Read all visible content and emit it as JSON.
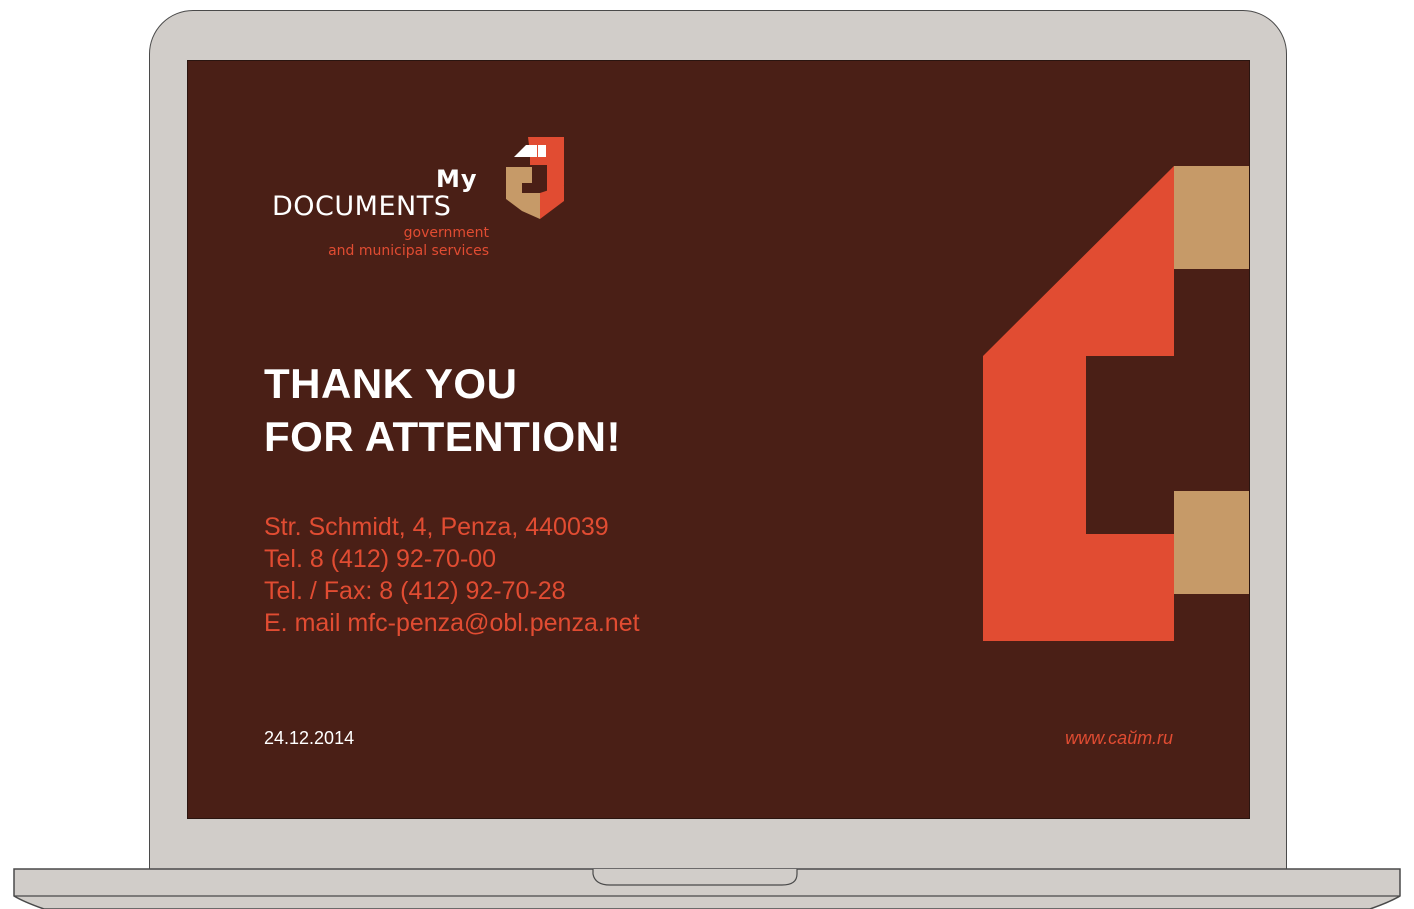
{
  "colors": {
    "slide_background": "#4a1f16",
    "accent_red": "#e14c32",
    "accent_tan": "#c69a68",
    "laptop_body": "#d1cdc9",
    "text_white": "#ffffff"
  },
  "logo": {
    "line1": "My",
    "line2": "DOCUMENTS",
    "subtitle_line1": "government",
    "subtitle_line2": "and municipal services",
    "mark_icon": "my-documents-logo-mark"
  },
  "heading": {
    "line1": "THANK YOU",
    "line2": "FOR ATTENTION!"
  },
  "contacts": {
    "address": "Str. Schmidt, 4, Penza, 440039",
    "tel": "Tel. 8 (412) 92-70-00",
    "fax": "Tel. / Fax: 8 (412) 92-70-28",
    "email": "E. mail mfc-penza@obl.penza.net"
  },
  "footer": {
    "date": "24.12.2014",
    "website": "www.caйт.ru"
  }
}
